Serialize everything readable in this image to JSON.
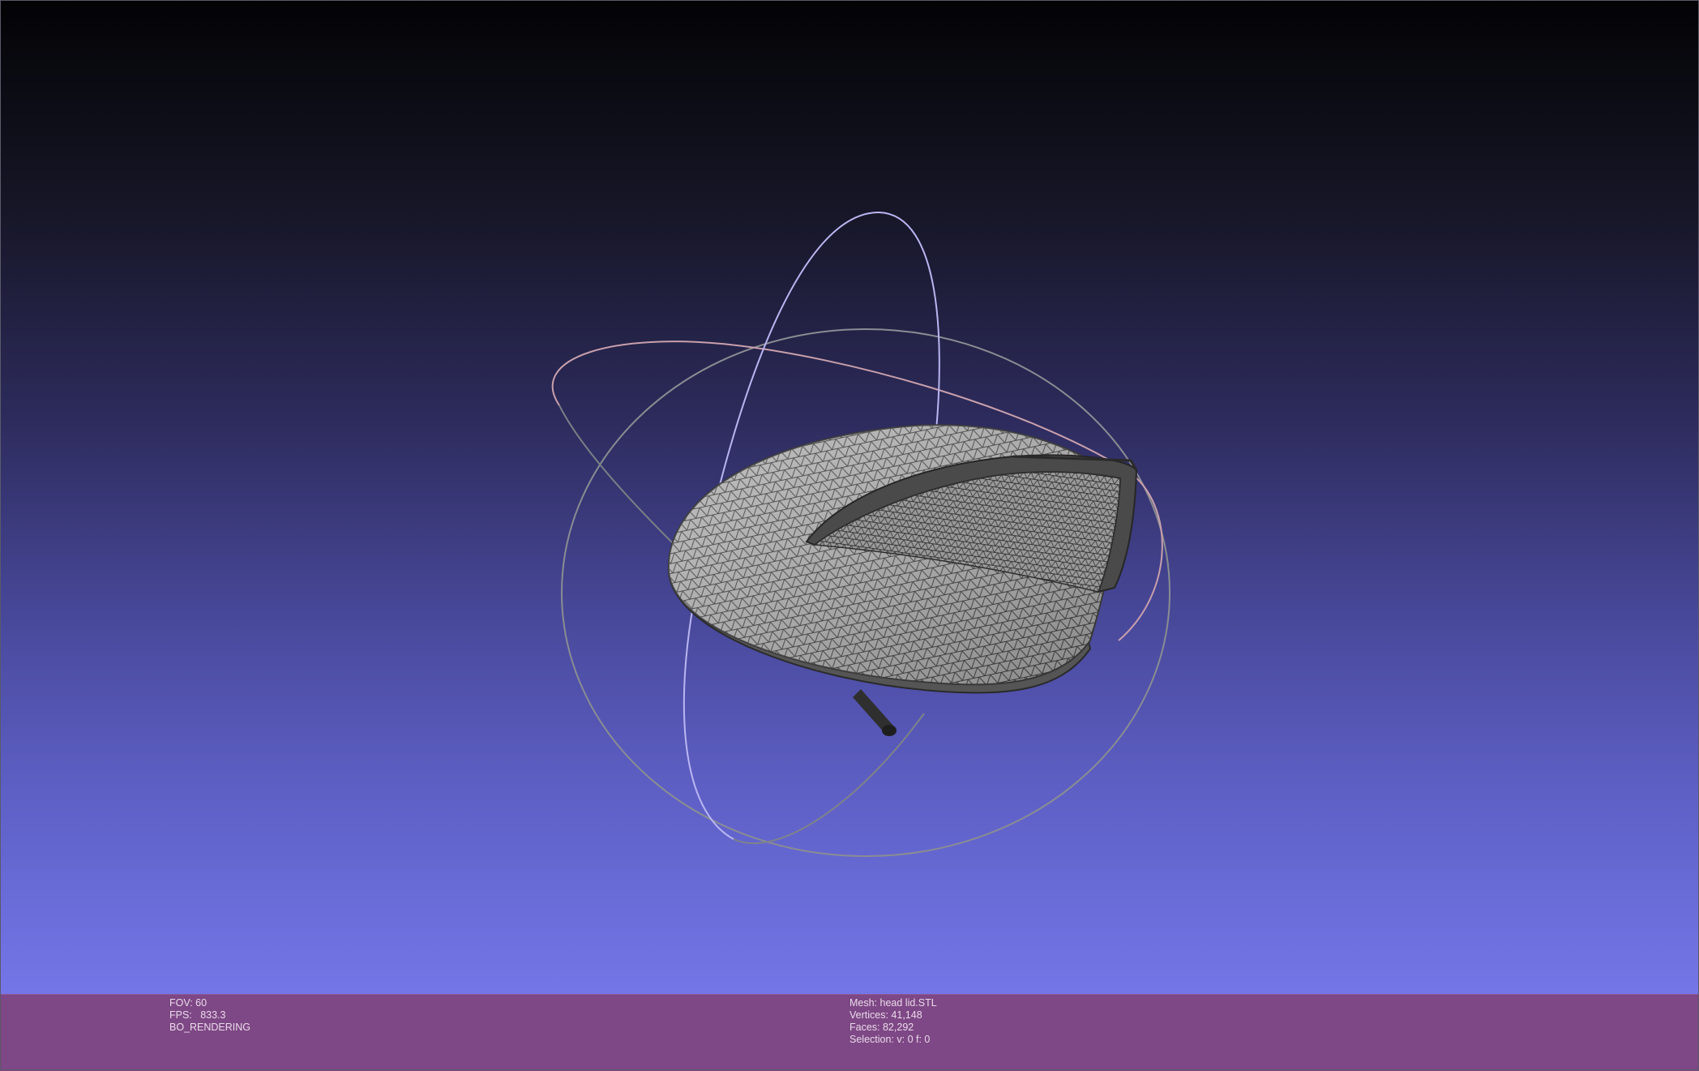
{
  "viewport": {
    "mesh_name": "head lid.STL"
  },
  "info_left": {
    "fov": "FOV: 60",
    "fps": "FPS:   833.3",
    "mode": "BO_RENDERING"
  },
  "info_right": {
    "mesh": "Mesh: head lid.STL",
    "vertices": "Vertices: 41,148",
    "faces": "Faces: 82,292",
    "selection": "Selection: v: 0 f: 0"
  },
  "colors": {
    "info_bar_bg": "#7e4785",
    "mesh_fill": "#a6a6a6",
    "mesh_wire": "#3a3a3a",
    "trackball_x": "#c79aa6",
    "trackball_y": "#b7b4ee",
    "trackball_z": "#8f9e98"
  }
}
